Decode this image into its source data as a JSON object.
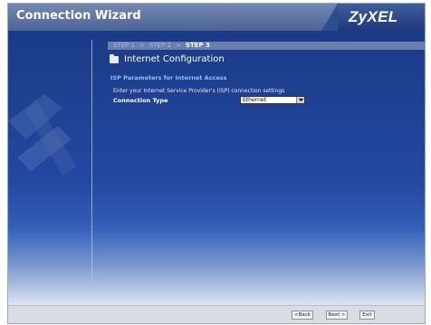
{
  "window": {
    "title": "Connection Wizard",
    "brand": "ZyXEL"
  },
  "steps": [
    {
      "label": "STEP 1",
      "state": "done"
    },
    {
      "label": "STEP 2",
      "state": "done"
    },
    {
      "label": "STEP 3",
      "state": "current"
    }
  ],
  "step_separator": ">",
  "section": {
    "title": "Internet Configuration",
    "icon": "folder-icon"
  },
  "isp": {
    "heading": "ISP Parameters for Internet Access",
    "description": "Enter your Internet Service Provider's (ISP) connection settings",
    "connection_type_label": "Connection Type",
    "connection_type_value": "Ethernet"
  },
  "buttons": {
    "back": "<Back",
    "next": "Next >",
    "exit": "Exit"
  },
  "colors": {
    "title_bar": "#5a6fa0",
    "background": "#1b3d86",
    "accent_text": "#8fc0ff",
    "footer": "#d9dce2"
  }
}
